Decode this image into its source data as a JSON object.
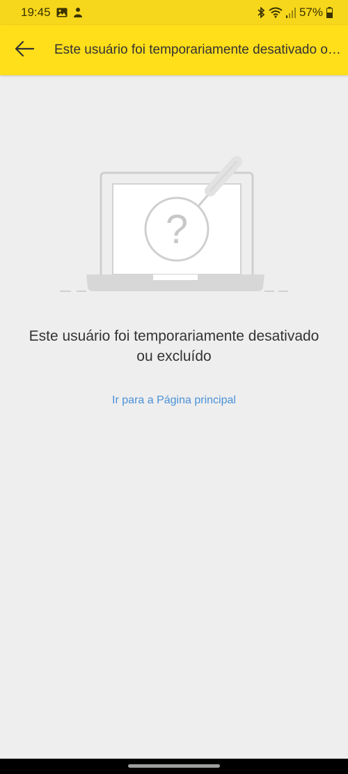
{
  "status_bar": {
    "time": "19:45",
    "battery_percent": "57%",
    "icons": [
      "image-icon",
      "notification-icon",
      "bluetooth-icon",
      "wifi-icon",
      "signal-icon",
      "battery-icon"
    ]
  },
  "app_bar": {
    "title": "Este usuário foi temporariamente desativado ou excluído",
    "back_icon": "arrow-left-icon"
  },
  "main": {
    "illustration_icon": "laptop-question-icon",
    "message": "Este usuário foi temporariamente desativado ou excluído",
    "home_link": "Ir para a Página principal"
  },
  "colors": {
    "app_bar": "#ffde1a",
    "status_bar": "#f7d71c",
    "background": "#eeeeee",
    "link": "#4a90d9",
    "text": "#333333"
  }
}
